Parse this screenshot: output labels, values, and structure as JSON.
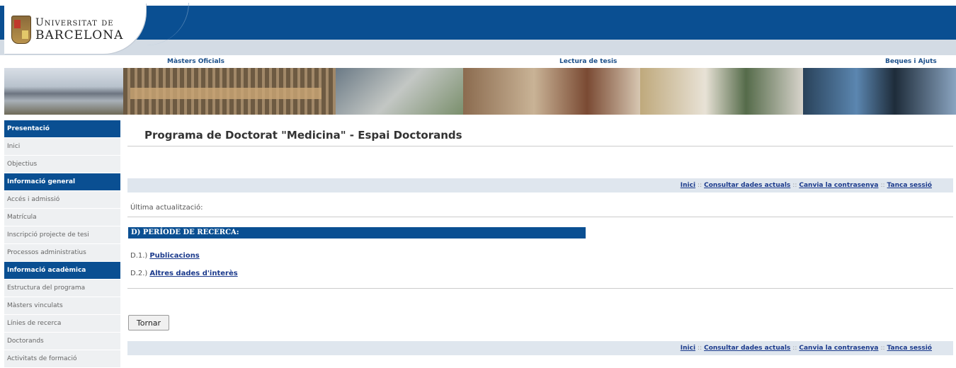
{
  "header": {
    "logo_line1": "Universitat de",
    "logo_line2": "BARCELONA",
    "nav": [
      "Màsters Oficials",
      "Lectura de tesis",
      "Beques i Ajuts"
    ]
  },
  "sidebar": {
    "sections": [
      {
        "heading": "Presentació",
        "items": [
          "Inici",
          "Objectius"
        ]
      },
      {
        "heading": "Informació general",
        "items": [
          "Accés i admissió",
          "Matrícula",
          "Inscripció projecte de tesi",
          "Processos administratius"
        ]
      },
      {
        "heading": "Informació acadèmica",
        "items": [
          "Estructura del programa",
          "Màsters vinculats",
          "Línies de recerca",
          "Doctorands",
          "Activitats de formació"
        ]
      }
    ]
  },
  "main": {
    "title": "Programa de Doctorat \"Medicina\" - Espai Doctorands",
    "links": {
      "home": "Inici",
      "current_data": "Consultar dades actuals",
      "change_password": "Canvia la contrasenya",
      "logout": "Tanca sessió",
      "separator": "::"
    },
    "last_update": "Última actualització:",
    "section_heading": "D) PERÍODE DE RECERCA:",
    "subsections": [
      {
        "prefix": "D.1.)",
        "label": "Publicacions"
      },
      {
        "prefix": "D.2.)",
        "label": "Altres dades d'interès"
      }
    ],
    "back_button": "Tornar"
  },
  "colors": {
    "brand_blue": "#0a4f92",
    "link_blue": "#1b3a8c",
    "bar_gray": "#dfe6ee"
  }
}
